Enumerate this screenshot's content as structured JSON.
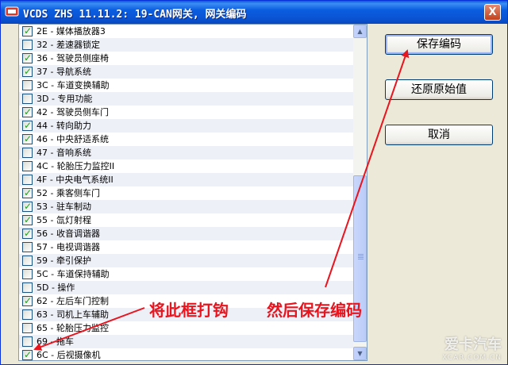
{
  "window": {
    "title": "VCDS ZHS 11.11.2: 19-CAN网关, 网关编码",
    "close_label": "X"
  },
  "list": {
    "items": [
      {
        "label": "2E - 媒体播放器3",
        "checked": true
      },
      {
        "label": "32 - 差速器锁定",
        "checked": false
      },
      {
        "label": "36 - 驾驶员侧座椅",
        "checked": true
      },
      {
        "label": "37 - 导航系统",
        "checked": true
      },
      {
        "label": "3C - 车道变换辅助",
        "checked": false
      },
      {
        "label": "3D - 专用功能",
        "checked": false
      },
      {
        "label": "42 - 驾驶员侧车门",
        "checked": true
      },
      {
        "label": "44 - 转向助力",
        "checked": true
      },
      {
        "label": "46 - 中央舒适系统",
        "checked": true
      },
      {
        "label": "47 - 音响系统",
        "checked": false
      },
      {
        "label": "4C - 轮胎压力监控II",
        "checked": false
      },
      {
        "label": "4F - 中央电气系统II",
        "checked": false
      },
      {
        "label": "52 - 乘客侧车门",
        "checked": true
      },
      {
        "label": "53 - 驻车制动",
        "checked": true
      },
      {
        "label": "55 - 氙灯射程",
        "checked": true
      },
      {
        "label": "56 - 收音调谐器",
        "checked": true
      },
      {
        "label": "57 - 电视调谐器",
        "checked": false
      },
      {
        "label": "59 - 牵引保护",
        "checked": false
      },
      {
        "label": "5C - 车道保持辅助",
        "checked": false
      },
      {
        "label": "5D - 操作",
        "checked": false
      },
      {
        "label": "62 - 左后车门控制",
        "checked": true
      },
      {
        "label": "63 - 司机上车辅助",
        "checked": false
      },
      {
        "label": "65 - 轮胎压力监控",
        "checked": false
      },
      {
        "label": "69 - 拖车",
        "checked": false
      },
      {
        "label": "6C - 后视摄像机",
        "checked": true
      }
    ]
  },
  "buttons": {
    "save": "保存编码",
    "restore": "还原原始值",
    "cancel": "取消"
  },
  "annotations": {
    "check_box_hint": "将此框打钩",
    "then_save_hint": "然后保存编码"
  },
  "watermark": {
    "brand": "爱卡汽车",
    "site": "XCAR.COM.CN"
  },
  "colors": {
    "annotation": "#e8141e",
    "titlebar": "#0a56d6",
    "check": "#21a121"
  },
  "icons": {
    "scroll_up": "▲",
    "scroll_down": "▼",
    "checkmark": "✓"
  }
}
